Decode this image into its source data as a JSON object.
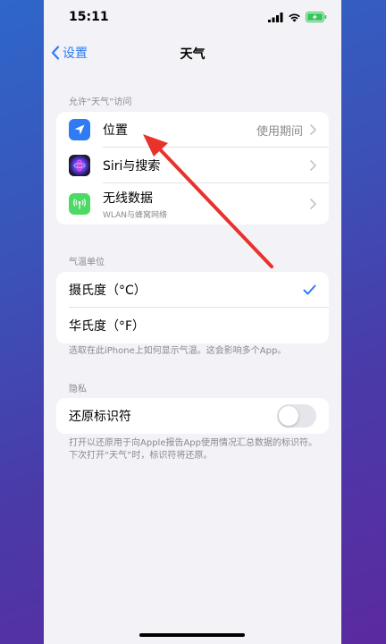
{
  "status_bar": {
    "time": "15:11"
  },
  "nav": {
    "back_label": "设置",
    "title": "天气"
  },
  "access_section": {
    "header": "允许“天气”访问",
    "items": [
      {
        "label": "位置",
        "value": "使用期间",
        "icon": "location-arrow-icon",
        "icon_color": "#2f7bf5"
      },
      {
        "label": "Siri与搜索",
        "icon": "siri-icon"
      },
      {
        "label": "无线数据",
        "sub": "WLAN与蜂窝网络",
        "icon": "antenna-icon",
        "icon_color": "#4cd964"
      }
    ]
  },
  "temp_section": {
    "header": "气温单位",
    "options": [
      {
        "label": "摄氏度（°C）",
        "selected": true
      },
      {
        "label": "华氏度（°F）",
        "selected": false
      }
    ],
    "footer": "选取在此iPhone上如何显示气温。这会影响多个App。"
  },
  "privacy_section": {
    "header": "隐私",
    "toggle_label": "还原标识符",
    "toggle_on": false,
    "footer": "打开以还原用于向Apple报告App使用情况汇总数据的标识符。下次打开“天气”时，标识符将还原。"
  },
  "colors": {
    "accent": "#2f7bf5",
    "annotation_arrow": "#e8322b"
  }
}
